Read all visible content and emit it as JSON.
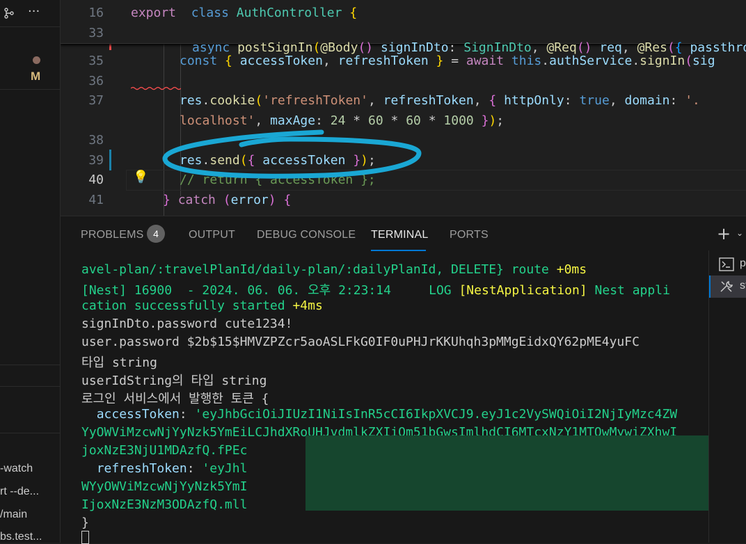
{
  "sidebar": {
    "items": [
      {
        "label": "-watch"
      },
      {
        "label": "rt --de..."
      },
      {
        "label": "/main"
      },
      {
        "label": "bs.test..."
      }
    ],
    "modified_badge": "M"
  },
  "editor": {
    "lines": [
      {
        "num": "16",
        "tokens": [
          [
            "kw",
            "export"
          ],
          [
            "",
            "  "
          ],
          [
            "kw2",
            "class"
          ],
          [
            "",
            " "
          ],
          [
            "cls",
            "AuthController"
          ],
          [
            "",
            " "
          ],
          [
            "br1",
            "{"
          ]
        ]
      },
      {
        "num": "33",
        "tokens": [
          [
            "",
            ""
          ]
        ]
      },
      {
        "num": "35",
        "tokens": [
          [
            "kw2",
            "const"
          ],
          [
            "",
            " "
          ],
          [
            "br1",
            "{"
          ],
          [
            "",
            " "
          ],
          [
            "var",
            "accessToken"
          ],
          [
            "",
            ", "
          ],
          [
            "var",
            "refreshToken"
          ],
          [
            "",
            " "
          ],
          [
            "br1",
            "}"
          ],
          [
            "",
            " = "
          ],
          [
            "kw",
            "await"
          ],
          [
            "",
            " "
          ],
          [
            "kw2",
            "this"
          ],
          [
            "",
            "."
          ],
          [
            "var",
            "authService"
          ],
          [
            "",
            "."
          ],
          [
            "fn",
            "signIn"
          ],
          [
            "br2",
            "("
          ],
          [
            "var",
            "sig"
          ]
        ]
      },
      {
        "num": "36",
        "tokens": []
      },
      {
        "num": "37",
        "tokens": [
          [
            "var",
            "res"
          ],
          [
            "",
            "."
          ],
          [
            "fn",
            "cookie"
          ],
          [
            "br1",
            "("
          ],
          [
            "str",
            "'refreshToken'"
          ],
          [
            "",
            ", "
          ],
          [
            "var",
            "refreshToken"
          ],
          [
            "",
            ", "
          ],
          [
            "br2",
            "{"
          ],
          [
            "",
            " "
          ],
          [
            "prop",
            "httpOnly"
          ],
          [
            "",
            ": "
          ],
          [
            "kw2",
            "true"
          ],
          [
            "",
            ", "
          ],
          [
            "prop",
            "domain"
          ],
          [
            "",
            ": "
          ],
          [
            "str",
            "'."
          ]
        ]
      },
      {
        "num": "",
        "tokens": [
          [
            "str",
            "localhost'"
          ],
          [
            "",
            ", "
          ],
          [
            "prop",
            "maxAge"
          ],
          [
            "",
            ": "
          ],
          [
            "num",
            "24"
          ],
          [
            "",
            " * "
          ],
          [
            "num",
            "60"
          ],
          [
            "",
            " * "
          ],
          [
            "num",
            "60"
          ],
          [
            "",
            " * "
          ],
          [
            "num",
            "1000"
          ],
          [
            "",
            " "
          ],
          [
            "br2",
            "}"
          ],
          [
            "br1",
            ")"
          ],
          [
            "",
            ";"
          ]
        ]
      },
      {
        "num": "38",
        "tokens": []
      },
      {
        "num": "39",
        "tokens": [
          [
            "var",
            "res"
          ],
          [
            "",
            "."
          ],
          [
            "fn",
            "send"
          ],
          [
            "br1",
            "("
          ],
          [
            "br2",
            "{"
          ],
          [
            "",
            " "
          ],
          [
            "var",
            "accessToken"
          ],
          [
            "",
            " "
          ],
          [
            "br2",
            "}"
          ],
          [
            "br1",
            ")"
          ],
          [
            "",
            ";"
          ]
        ]
      },
      {
        "num": "40",
        "tokens": [
          [
            "cmt",
            "// return { accessToken };"
          ]
        ]
      },
      {
        "num": "41",
        "tokens": [
          [
            "br2",
            "}"
          ],
          [
            "",
            " "
          ],
          [
            "kw",
            "catch"
          ],
          [
            "",
            " "
          ],
          [
            "br2",
            "("
          ],
          [
            "var",
            "error"
          ],
          [
            "br2",
            ")"
          ],
          [
            "",
            " "
          ],
          [
            "br2",
            "{"
          ]
        ]
      }
    ],
    "sticky_line": {
      "num": "33",
      "text": "async postSignIn(@Body() signInDto: SignInDto, @Req() req, @Res({ passthrou"
    }
  },
  "panel": {
    "tabs": [
      {
        "label": "PROBLEMS",
        "active": false
      },
      {
        "label": "OUTPUT",
        "active": false
      },
      {
        "label": "DEBUG CONSOLE",
        "active": false
      },
      {
        "label": "TERMINAL",
        "active": true
      },
      {
        "label": "PORTS",
        "active": false
      }
    ],
    "problems_count": "4",
    "terminal": {
      "lines": [
        [
          [
            "g",
            "avel-plan/:travelPlanId/daily-plan/:dailyPlanId, DELETE} route "
          ],
          [
            "y",
            "+0ms"
          ]
        ],
        [
          [
            "g",
            "[Nest] 16900  - 2024. 06. 06. 오후 2:23:14     LOG "
          ],
          [
            "y",
            "[NestApplication]"
          ],
          [
            "g",
            " Nest appli"
          ]
        ],
        [
          [
            "g",
            "cation successfully started "
          ],
          [
            "y",
            "+4ms"
          ]
        ],
        [
          [
            "",
            "signInDto.password cute1234!"
          ]
        ],
        [
          [
            "",
            "user.password $2b$15$HMVZPZcr5aoASLFkG0IF0uPHJrKKUhqh3pMMgEidxQY62pME4yuFC"
          ]
        ],
        [
          [
            "",
            "타입 string"
          ]
        ],
        [
          [
            "",
            "userIdString의 타입 string"
          ]
        ],
        [
          [
            "",
            "로그인 서비스에서 발행한 토큰 {"
          ]
        ],
        [
          [
            "",
            "  "
          ],
          [
            "jk",
            "accessToken"
          ],
          [
            "",
            ": "
          ],
          [
            "jv",
            "'eyJhbGciOiJIUzI1NiIsInR5cCI6IkpXVCJ9.eyJ1c2VySWQiOiI2NjIyMzc4ZW"
          ]
        ],
        [
          [
            "jv",
            "YyOWViMzcwNjYyNzk5YmEiLCJhdXRoUHJvdmlkZXIiOm51bGwsImlhdCI6MTcxNzY1MTOwMywiZXhwI"
          ]
        ],
        [
          [
            "jv",
            "joxNzE3NjU1MDAzfQ.fPEc"
          ]
        ],
        [
          [
            "",
            "  "
          ],
          [
            "jk",
            "refreshToken"
          ],
          [
            "",
            ": "
          ],
          [
            "jv",
            "'eyJhl                                                              Mzc4Z"
          ]
        ],
        [
          [
            "jv",
            "WYyOWViMzcwNjYyNzk5YmI                                                              iZXhw"
          ]
        ],
        [
          [
            "jv",
            "IjoxNzE3NzM3ODAzfQ.mll"
          ]
        ],
        [
          [
            "",
            "}"
          ]
        ]
      ]
    }
  },
  "right_panel": {
    "items": [
      {
        "label": "p"
      },
      {
        "label": "st"
      }
    ]
  },
  "colors": {
    "accent": "#0078d4",
    "annotation_circle": "#1aa7d4",
    "terminal_green": "#23d18b",
    "terminal_yellow": "#f5f543"
  }
}
